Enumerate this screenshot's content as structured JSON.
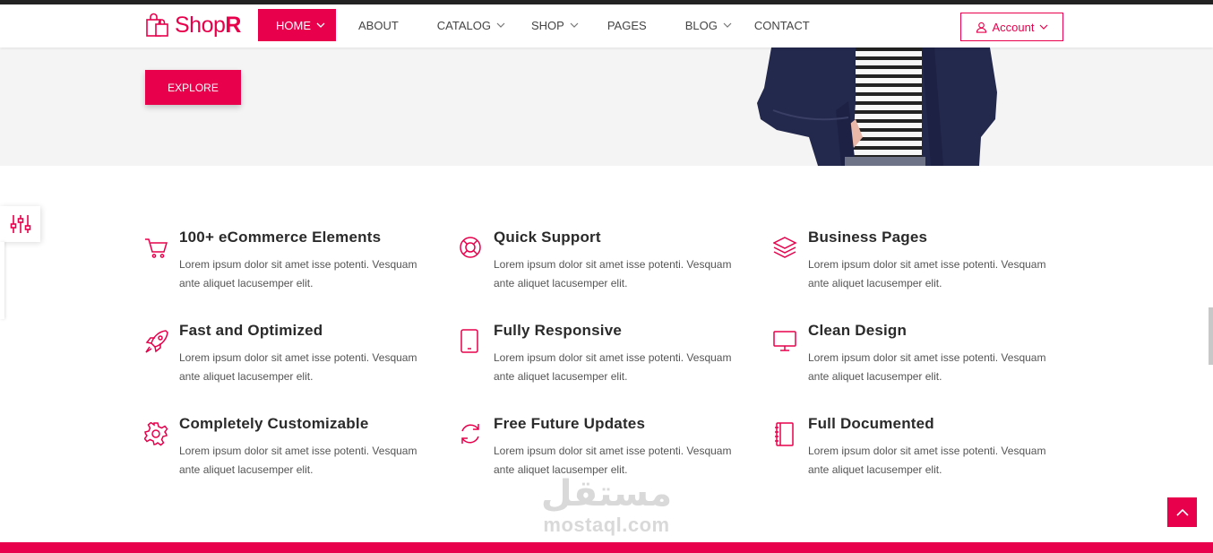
{
  "brand": {
    "name_light": "Shop",
    "name_bold": "R",
    "accent": "#e8004c"
  },
  "nav": {
    "items": [
      {
        "label": "HOME",
        "active": true,
        "dropdown": true
      },
      {
        "label": "ABOUT",
        "active": false,
        "dropdown": false
      },
      {
        "label": "CATALOG",
        "active": false,
        "dropdown": true
      },
      {
        "label": "SHOP",
        "active": false,
        "dropdown": true
      },
      {
        "label": "PAGES",
        "active": false,
        "dropdown": false
      },
      {
        "label": "BLOG",
        "active": false,
        "dropdown": true
      },
      {
        "label": "CONTACT",
        "active": false,
        "dropdown": false
      }
    ],
    "account_label": "Account"
  },
  "hero": {
    "button_label": "EXPLORE"
  },
  "features": [
    {
      "icon": "cart-icon",
      "title": "100+ eCommerce Elements",
      "text": "Lorem ipsum dolor sit amet isse potenti. Vesquam ante aliquet lacusemper elit."
    },
    {
      "icon": "lifebuoy-icon",
      "title": "Quick Support",
      "text": "Lorem ipsum dolor sit amet isse potenti. Vesquam ante aliquet lacusemper elit."
    },
    {
      "icon": "layers-icon",
      "title": "Business Pages",
      "text": "Lorem ipsum dolor sit amet isse potenti. Vesquam ante aliquet lacusemper elit."
    },
    {
      "icon": "rocket-icon",
      "title": "Fast and Optimized",
      "text": "Lorem ipsum dolor sit amet isse potenti. Vesquam ante aliquet lacusemper elit."
    },
    {
      "icon": "tablet-icon",
      "title": "Fully Responsive",
      "text": "Lorem ipsum dolor sit amet isse potenti. Vesquam ante aliquet lacusemper elit."
    },
    {
      "icon": "monitor-icon",
      "title": "Clean Design",
      "text": "Lorem ipsum dolor sit amet isse potenti. Vesquam ante aliquet lacusemper elit."
    },
    {
      "icon": "gear-icon",
      "title": "Completely Customizable",
      "text": "Lorem ipsum dolor sit amet isse potenti. Vesquam ante aliquet lacusemper elit."
    },
    {
      "icon": "refresh-icon",
      "title": "Free Future Updates",
      "text": "Lorem ipsum dolor sit amet isse potenti. Vesquam ante aliquet lacusemper elit."
    },
    {
      "icon": "notebook-icon",
      "title": "Full Documented",
      "text": "Lorem ipsum dolor sit amet isse potenti. Vesquam ante aliquet lacusemper elit."
    }
  ],
  "watermark": {
    "arabic": "مستقل",
    "latin": "mostaql.com"
  }
}
